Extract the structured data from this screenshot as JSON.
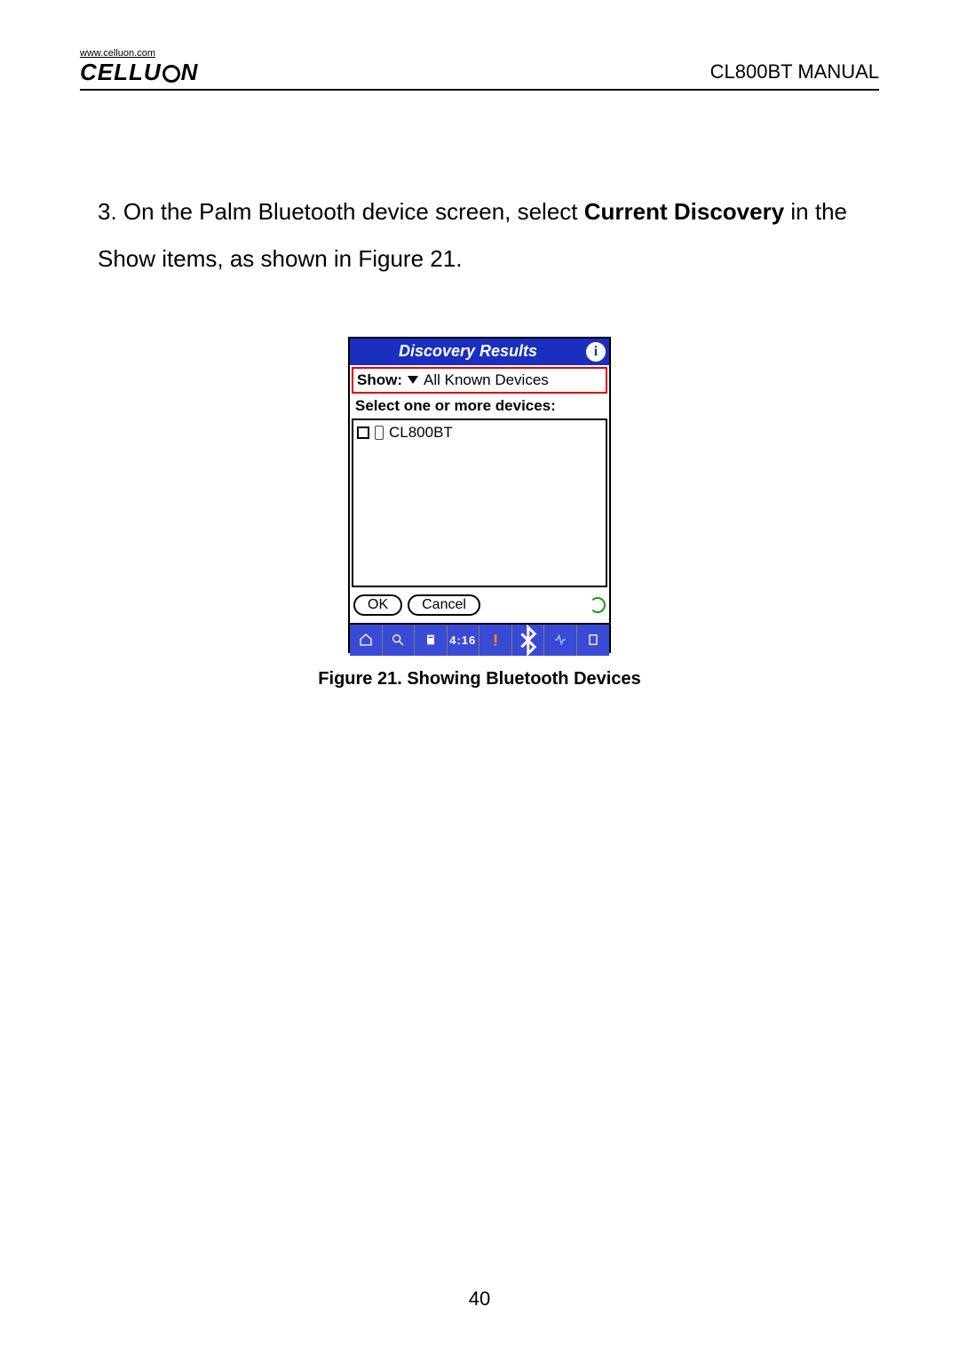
{
  "header": {
    "brand_url": "www.celluon.com",
    "brand_left": "CELLU",
    "brand_right": "N",
    "manual_title": "CL800BT MANUAL"
  },
  "instruction": {
    "prefix": "3. On the Palm Bluetooth device screen, select ",
    "bold1": "Current Discovery",
    "middle": " in the Show items, as shown in Figure 21."
  },
  "palm": {
    "title": "Discovery Results",
    "show_label": "Show:",
    "show_value": "All Known Devices",
    "select_label": "Select one or more devices:",
    "device_name": "CL800BT",
    "ok_label": "OK",
    "cancel_label": "Cancel",
    "time": "4:16",
    "bt_glyph": "Ʉ"
  },
  "caption": "Figure 21. Showing Bluetooth Devices",
  "page_number": "40"
}
